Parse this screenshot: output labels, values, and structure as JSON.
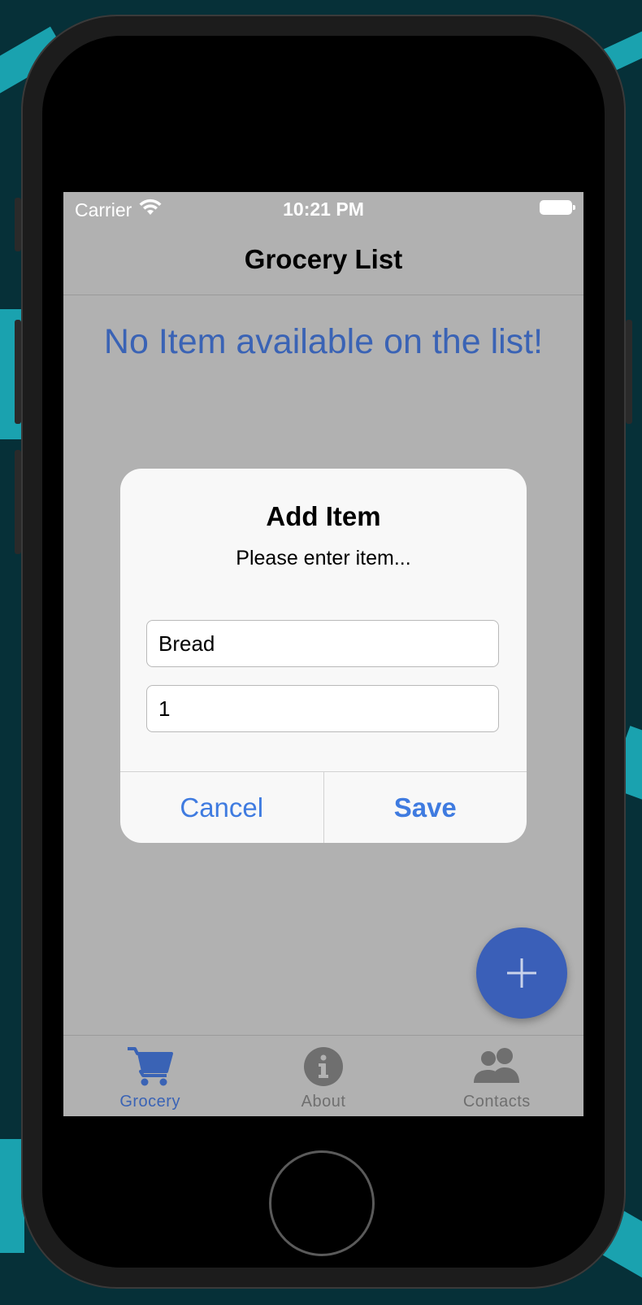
{
  "status_bar": {
    "carrier": "Carrier",
    "time": "10:21 PM",
    "wifi_icon": "wifi-icon",
    "battery_icon": "battery-icon"
  },
  "nav": {
    "title": "Grocery List"
  },
  "main": {
    "empty_message": "No Item available on the list!"
  },
  "dialog": {
    "title": "Add Item",
    "message": "Please enter item...",
    "item_name_value": "Bread",
    "quantity_value": "1",
    "cancel_label": "Cancel",
    "save_label": "Save"
  },
  "fab": {
    "icon": "plus-icon"
  },
  "tabs": [
    {
      "label": "Grocery",
      "icon": "cart-icon",
      "active": true
    },
    {
      "label": "About",
      "icon": "info-icon",
      "active": false
    },
    {
      "label": "Contacts",
      "icon": "people-icon",
      "active": false
    }
  ],
  "colors": {
    "accent": "#3a63b5",
    "button_text": "#3f7be0",
    "screen_dim": "#b1b1b1"
  }
}
